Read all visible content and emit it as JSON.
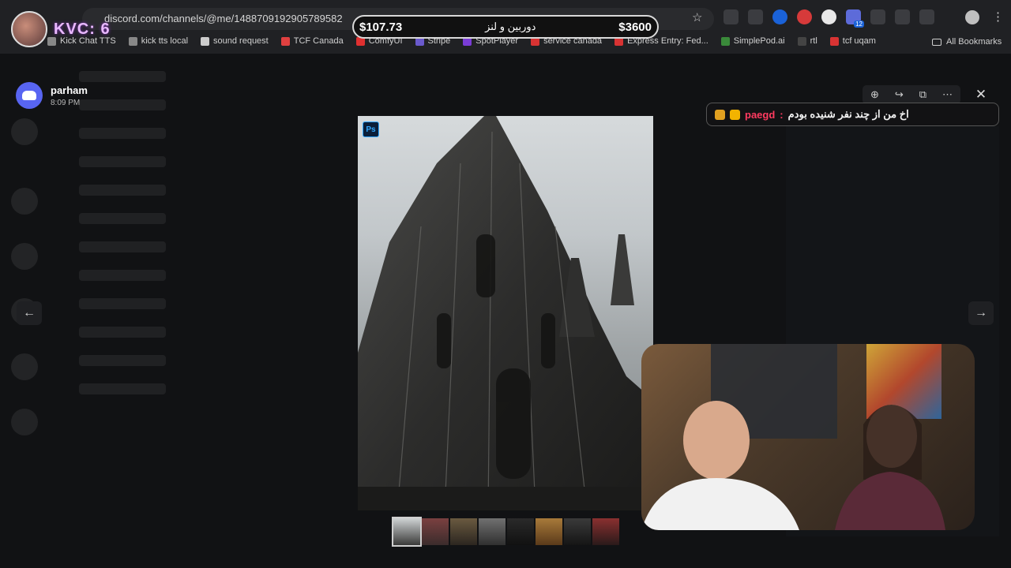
{
  "browser": {
    "url": "discord.com/channels/@me/1488709192905789582",
    "bookmarks": [
      "Kick Chat TTS",
      "kick tts local",
      "sound request",
      "TCF Canada",
      "ComfyUI",
      "Stripe",
      "SpotPlayer",
      "service canada",
      "Express Entry: Fed...",
      "SimplePod.ai",
      "rtl",
      "tcf uqam"
    ],
    "all_bookmarks": "All Bookmarks",
    "extension_badge": "12",
    "colors": {
      "bookmark_icons": [
        "#888888",
        "#888888",
        "#cccccc",
        "#e04040",
        "#e03030",
        "#6a5acd",
        "#7a3cd6",
        "#d83333",
        "#d83333",
        "#3a8a3a",
        "#444444",
        "#d83333"
      ]
    }
  },
  "overlay": {
    "counter": "KVC: 6",
    "pill_left": "$107.73",
    "pill_middle": "دوربین و لنز",
    "pill_right": "$3600"
  },
  "viewer": {
    "username": "parham",
    "time": "8:09 PM",
    "tools": [
      "zoom-in-icon",
      "forward-icon",
      "open-external-icon",
      "more-icon"
    ],
    "photoshop_badge": "Ps",
    "thumbnail_count": 8,
    "selected_thumbnail": 1
  },
  "chat": {
    "user": "paegd",
    "separator": " :",
    "message": "اخ من از چند نفر شنیده بودم"
  }
}
